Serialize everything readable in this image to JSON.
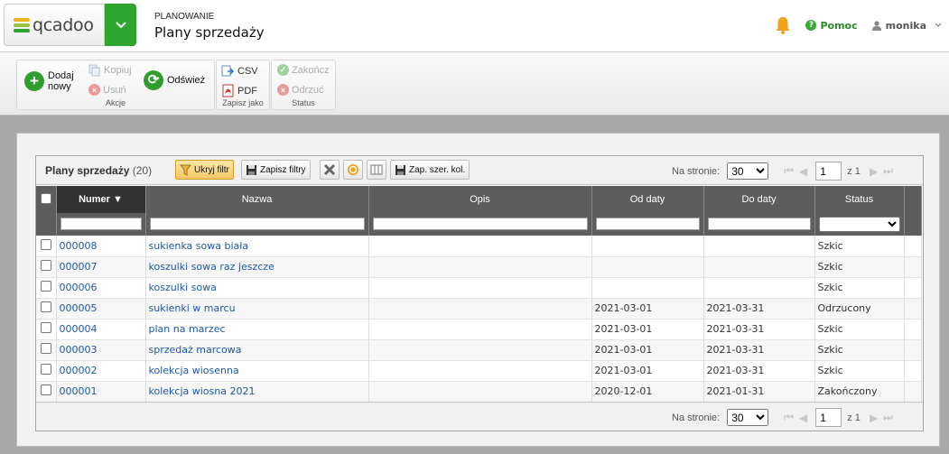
{
  "header": {
    "logo": "qcadoo",
    "section": "PLANOWANIE",
    "title": "Plany sprzedaży",
    "help": "Pomoc",
    "user": "monika"
  },
  "ribbon": {
    "add_label_1": "Dodaj",
    "add_label_2": "nowy",
    "copy": "Kopiuj",
    "delete": "Usuń",
    "group_actions": "Akcje",
    "refresh": "Odśwież",
    "csv": "CSV",
    "pdf": "PDF",
    "group_save_as": "Zapisz jako",
    "finish": "Zakończ",
    "reject": "Odrzuć",
    "group_status": "Status"
  },
  "grid": {
    "title": "Plany sprzedaży",
    "count": "(20)",
    "hide_filter": "Ukryj filtr",
    "save_filters": "Zapisz filtry",
    "save_col_width": "Zap. szer. kol.",
    "per_page_label": "Na stronie:",
    "per_page": "30",
    "page": "1",
    "of_pages": "z 1",
    "columns": [
      "Numer",
      "Nazwa",
      "Opis",
      "Od daty",
      "Do daty",
      "Status"
    ],
    "rows": [
      {
        "number": "000008",
        "name": "sukienka sowa biała",
        "desc": "",
        "from": "",
        "to": "",
        "status": "Szkic"
      },
      {
        "number": "000007",
        "name": "koszulki sowa raz jeszcze",
        "desc": "",
        "from": "",
        "to": "",
        "status": "Szkic"
      },
      {
        "number": "000006",
        "name": "koszulki sowa",
        "desc": "",
        "from": "",
        "to": "",
        "status": "Szkic"
      },
      {
        "number": "000005",
        "name": "sukienki w marcu",
        "desc": "",
        "from": "2021-03-01",
        "to": "2021-03-31",
        "status": "Odrzucony"
      },
      {
        "number": "000004",
        "name": "plan na marzec",
        "desc": "",
        "from": "2021-03-01",
        "to": "2021-03-31",
        "status": "Szkic"
      },
      {
        "number": "000003",
        "name": "sprzedaż marcowa",
        "desc": "",
        "from": "2021-03-01",
        "to": "2021-03-31",
        "status": "Szkic"
      },
      {
        "number": "000002",
        "name": "kolekcja wiosenna",
        "desc": "",
        "from": "2021-03-01",
        "to": "2021-03-31",
        "status": "Szkic"
      },
      {
        "number": "000001",
        "name": "kolekcja wiosna 2021",
        "desc": "",
        "from": "2020-12-01",
        "to": "2021-01-31",
        "status": "Zakończony"
      }
    ]
  },
  "colors": {
    "brand_green": "#2ea52e",
    "link_blue": "#1c57a5",
    "header_grey": "#5d5d5d",
    "bell_orange": "#f0a21a"
  }
}
